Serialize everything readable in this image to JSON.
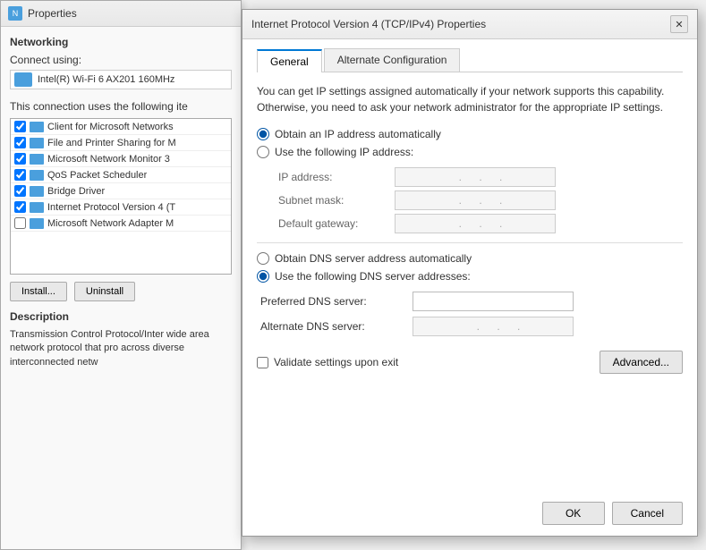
{
  "bgWindow": {
    "title": "Properties",
    "networking": {
      "sectionLabel": "Networking",
      "connectUsing": "Connect using:",
      "adapterName": "Intel(R) Wi-Fi 6 AX201 160MHz",
      "connectionListLabel": "This connection uses the following ite",
      "items": [
        {
          "checked": true,
          "text": "Client for Microsoft Networks"
        },
        {
          "checked": true,
          "text": "File and Printer Sharing for M"
        },
        {
          "checked": true,
          "text": "Microsoft Network Monitor 3"
        },
        {
          "checked": true,
          "text": "QoS Packet Scheduler"
        },
        {
          "checked": true,
          "text": "Bridge Driver"
        },
        {
          "checked": true,
          "text": "Internet Protocol Version 4 (T"
        },
        {
          "checked": false,
          "text": "Microsoft Network Adapter M"
        }
      ]
    },
    "buttons": {
      "install": "Install...",
      "uninstall": "Uninstall"
    },
    "description": {
      "label": "Description",
      "text": "Transmission Control Protocol/Inter wide area network protocol that pro across diverse interconnected netw"
    }
  },
  "dialog": {
    "title": "Internet Protocol Version 4 (TCP/IPv4) Properties",
    "closeLabel": "✕",
    "tabs": [
      {
        "label": "General",
        "active": true
      },
      {
        "label": "Alternate Configuration",
        "active": false
      }
    ],
    "infoText": "You can get IP settings assigned automatically if your network supports this capability. Otherwise, you need to ask your network administrator for the appropriate IP settings.",
    "ipSection": {
      "autoObtain": {
        "label": "Obtain an IP address automatically",
        "selected": true
      },
      "useFollowing": {
        "label": "Use the following IP address:",
        "selected": false
      },
      "fields": [
        {
          "label": "IP address:",
          "dots": ". . ."
        },
        {
          "label": "Subnet mask:",
          "dots": ". . ."
        },
        {
          "label": "Default gateway:",
          "dots": ". . ."
        }
      ]
    },
    "dnsSection": {
      "autoObtain": {
        "label": "Obtain DNS server address automatically",
        "selected": false
      },
      "useFollowing": {
        "label": "Use the following DNS server addresses:",
        "selected": true
      },
      "fields": [
        {
          "label": "Preferred DNS server:",
          "value": "",
          "disabled": false
        },
        {
          "label": "Alternate DNS server:",
          "value": ". . .",
          "disabled": true
        }
      ]
    },
    "validateLabel": "Validate settings upon exit",
    "advancedButton": "Advanced...",
    "okButton": "OK",
    "cancelButton": "Cancel"
  }
}
